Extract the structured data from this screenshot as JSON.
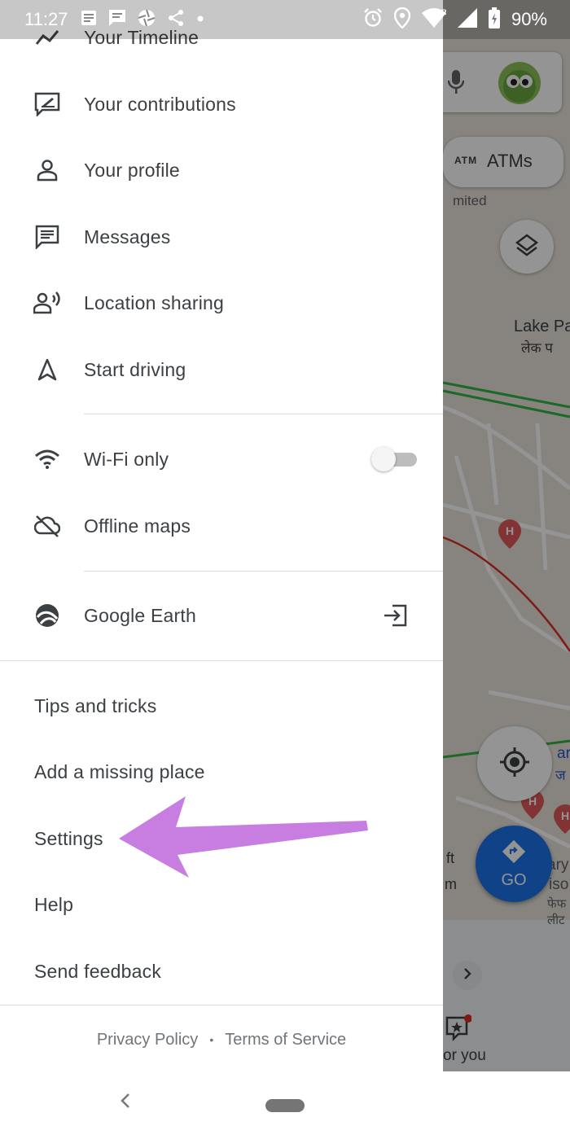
{
  "status_bar": {
    "time": "11:27",
    "battery": "90%",
    "left_icons": [
      "article-icon",
      "message-icon",
      "aperture-icon",
      "share-icon",
      "dot-icon"
    ],
    "right_icons": [
      "alarm-icon",
      "location-pin-icon",
      "wifi-icon",
      "cell-signal-icon",
      "battery-charging-icon"
    ]
  },
  "map": {
    "atm_chip_label": "ATMs",
    "atm_chip_badge": "ATM",
    "labels": {
      "mited": "mited",
      "lake": "Lake Pa",
      "lake_hindi": "लेक प",
      "ft": "ft",
      "m": "m",
      "ary": "ary",
      "iso": "iso",
      "hin1": "फेफ",
      "hin2": "लीट",
      "for_you": "or you",
      "go": "GO",
      "jar": "ar",
      "jan": "ज"
    }
  },
  "drawer": {
    "menu_items": [
      {
        "label": "Your Timeline",
        "icon": "timeline-icon"
      },
      {
        "label": "Your contributions",
        "icon": "contributions-icon"
      },
      {
        "label": "Your profile",
        "icon": "person-icon"
      },
      {
        "label": "Messages",
        "icon": "message-icon"
      },
      {
        "label": "Location sharing",
        "icon": "location-sharing-icon"
      },
      {
        "label": "Start driving",
        "icon": "navigation-arrow-icon"
      }
    ],
    "settings_items": [
      {
        "label": "Wi-Fi only",
        "icon": "wifi-icon",
        "toggle_on": false
      },
      {
        "label": "Offline maps",
        "icon": "offline-cloud-icon"
      }
    ],
    "earth_item": {
      "label": "Google Earth",
      "icon": "google-earth-icon",
      "action_icon": "open-external-icon"
    },
    "text_items": [
      "Tips and tricks",
      "Add a missing place",
      "Settings",
      "Help",
      "Send feedback"
    ],
    "footer": {
      "privacy": "Privacy Policy",
      "separator": "•",
      "terms": "Terms of Service"
    }
  },
  "annotation": {
    "color": "#c77ee0",
    "target": "Settings"
  },
  "colors": {
    "accent_blue": "#1a73e8",
    "go_button": "#2a56c6",
    "text": "#3c4043",
    "divider": "#dadce0"
  }
}
